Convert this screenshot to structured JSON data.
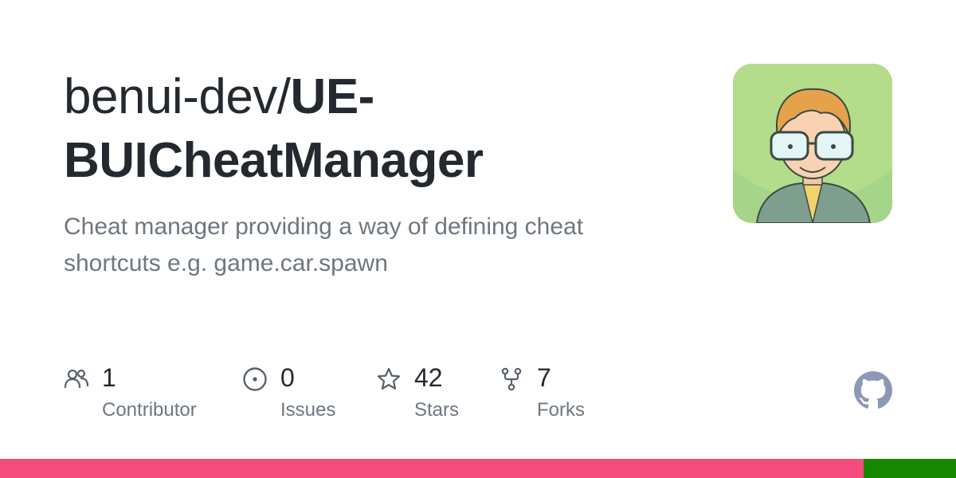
{
  "repo": {
    "owner": "benui-dev/",
    "name": "UE-BUICheatManager",
    "description": "Cheat manager providing a way of defining cheat shortcuts e.g. game.car.spawn"
  },
  "stats": [
    {
      "icon": "people-icon",
      "value": "1",
      "label": "Contributor"
    },
    {
      "icon": "issue-icon",
      "value": "0",
      "label": "Issues"
    },
    {
      "icon": "star-icon",
      "value": "42",
      "label": "Stars"
    },
    {
      "icon": "fork-icon",
      "value": "7",
      "label": "Forks"
    }
  ],
  "languages": [
    {
      "color": "#f34b7d",
      "share": 0.903
    },
    {
      "color": "#178600",
      "share": 0.097
    }
  ],
  "colors": {
    "title": "#24292f",
    "muted": "#6e7781",
    "icon": "#57606a",
    "github_logo": "#8b98b6",
    "avatar_bg": "#a5d588"
  }
}
